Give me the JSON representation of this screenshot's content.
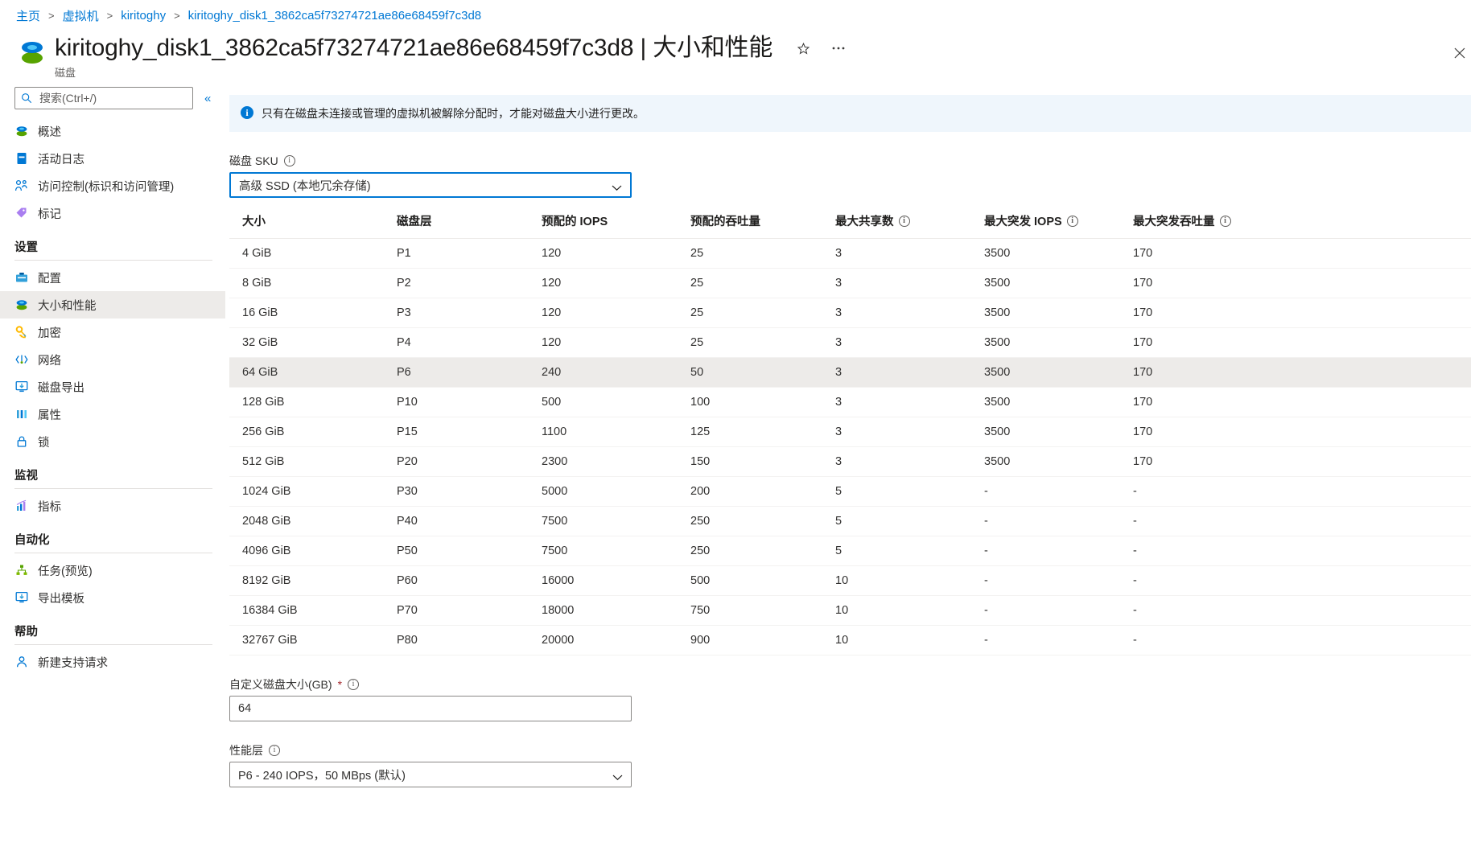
{
  "breadcrumb": {
    "items": [
      {
        "label": "主页"
      },
      {
        "label": "虚拟机"
      },
      {
        "label": "kiritoghy"
      },
      {
        "label": "kiritoghy_disk1_3862ca5f73274721ae86e68459f7c3d8"
      }
    ],
    "separator": ">"
  },
  "header": {
    "title": "kiritoghy_disk1_3862ca5f73274721ae86e68459f7c3d8 | 大小和性能",
    "subtitle": "磁盘",
    "favorite_icon": "star-outline-icon",
    "more_icon": "ellipsis-icon",
    "close_icon": "close-icon"
  },
  "sidebar": {
    "search": {
      "placeholder": "搜索(Ctrl+/)",
      "value": "",
      "icon": "search-icon"
    },
    "collapse_label": "«",
    "top_items": [
      {
        "label": "概述",
        "icon": "disk-icon",
        "selected": false
      },
      {
        "label": "活动日志",
        "icon": "activity-log-icon",
        "selected": false
      },
      {
        "label": "访问控制(标识和访问管理)",
        "icon": "access-control-icon",
        "selected": false
      },
      {
        "label": "标记",
        "icon": "tag-icon",
        "selected": false
      }
    ],
    "groups": [
      {
        "title": "设置",
        "items": [
          {
            "label": "配置",
            "icon": "configuration-icon",
            "selected": false
          },
          {
            "label": "大小和性能",
            "icon": "disk-icon",
            "selected": true
          },
          {
            "label": "加密",
            "icon": "key-icon",
            "selected": false
          },
          {
            "label": "网络",
            "icon": "network-icon",
            "selected": false
          },
          {
            "label": "磁盘导出",
            "icon": "disk-export-icon",
            "selected": false
          },
          {
            "label": "属性",
            "icon": "properties-icon",
            "selected": false
          },
          {
            "label": "锁",
            "icon": "lock-icon",
            "selected": false
          }
        ]
      },
      {
        "title": "监视",
        "items": [
          {
            "label": "指标",
            "icon": "metrics-icon",
            "selected": false
          }
        ]
      },
      {
        "title": "自动化",
        "items": [
          {
            "label": "任务(预览)",
            "icon": "tasks-icon",
            "selected": false
          },
          {
            "label": "导出模板",
            "icon": "export-template-icon",
            "selected": false
          }
        ]
      },
      {
        "title": "帮助",
        "items": [
          {
            "label": "新建支持请求",
            "icon": "support-request-icon",
            "selected": false
          }
        ]
      }
    ]
  },
  "main": {
    "info_banner": {
      "icon": "info-icon",
      "text": "只有在磁盘未连接或管理的虚拟机被解除分配时，才能对磁盘大小进行更改。"
    },
    "disk_sku": {
      "label": "磁盘 SKU",
      "info_icon": "info-circle-icon",
      "value": "高级 SSD (本地冗余存储)",
      "chevron": "chevron-down-icon"
    },
    "custom_size": {
      "label": "自定义磁盘大小(GB)",
      "required_marker": "*",
      "info_icon": "info-circle-icon",
      "value": "64"
    },
    "performance_tier": {
      "label": "性能层",
      "info_icon": "info-circle-icon",
      "value": "P6 - 240 IOPS，50 MBps (默认)",
      "chevron": "chevron-down-icon"
    }
  },
  "chart_data": {
    "type": "table",
    "title": "磁盘 SKU 大小与性能表",
    "columns": [
      {
        "key": "size",
        "label": "大小",
        "info": false
      },
      {
        "key": "tier",
        "label": "磁盘层",
        "info": false
      },
      {
        "key": "iops",
        "label": "预配的 IOPS",
        "info": false
      },
      {
        "key": "thr",
        "label": "预配的吞吐量",
        "info": false
      },
      {
        "key": "shares",
        "label": "最大共享数",
        "info": true
      },
      {
        "key": "burst",
        "label": "最大突发 IOPS",
        "info": true
      },
      {
        "key": "bthr",
        "label": "最大突发吞吐量",
        "info": true
      }
    ],
    "selected_row_index": 4,
    "rows": [
      {
        "size": "4 GiB",
        "tier": "P1",
        "iops": "120",
        "thr": "25",
        "shares": "3",
        "burst": "3500",
        "bthr": "170"
      },
      {
        "size": "8 GiB",
        "tier": "P2",
        "iops": "120",
        "thr": "25",
        "shares": "3",
        "burst": "3500",
        "bthr": "170"
      },
      {
        "size": "16 GiB",
        "tier": "P3",
        "iops": "120",
        "thr": "25",
        "shares": "3",
        "burst": "3500",
        "bthr": "170"
      },
      {
        "size": "32 GiB",
        "tier": "P4",
        "iops": "120",
        "thr": "25",
        "shares": "3",
        "burst": "3500",
        "bthr": "170"
      },
      {
        "size": "64 GiB",
        "tier": "P6",
        "iops": "240",
        "thr": "50",
        "shares": "3",
        "burst": "3500",
        "bthr": "170"
      },
      {
        "size": "128 GiB",
        "tier": "P10",
        "iops": "500",
        "thr": "100",
        "shares": "3",
        "burst": "3500",
        "bthr": "170"
      },
      {
        "size": "256 GiB",
        "tier": "P15",
        "iops": "1100",
        "thr": "125",
        "shares": "3",
        "burst": "3500",
        "bthr": "170"
      },
      {
        "size": "512 GiB",
        "tier": "P20",
        "iops": "2300",
        "thr": "150",
        "shares": "3",
        "burst": "3500",
        "bthr": "170"
      },
      {
        "size": "1024 GiB",
        "tier": "P30",
        "iops": "5000",
        "thr": "200",
        "shares": "5",
        "burst": "-",
        "bthr": "-"
      },
      {
        "size": "2048 GiB",
        "tier": "P40",
        "iops": "7500",
        "thr": "250",
        "shares": "5",
        "burst": "-",
        "bthr": "-"
      },
      {
        "size": "4096 GiB",
        "tier": "P50",
        "iops": "7500",
        "thr": "250",
        "shares": "5",
        "burst": "-",
        "bthr": "-"
      },
      {
        "size": "8192 GiB",
        "tier": "P60",
        "iops": "16000",
        "thr": "500",
        "shares": "10",
        "burst": "-",
        "bthr": "-"
      },
      {
        "size": "16384 GiB",
        "tier": "P70",
        "iops": "18000",
        "thr": "750",
        "shares": "10",
        "burst": "-",
        "bthr": "-"
      },
      {
        "size": "32767 GiB",
        "tier": "P80",
        "iops": "20000",
        "thr": "900",
        "shares": "10",
        "burst": "-",
        "bthr": "-"
      }
    ]
  },
  "colors": {
    "accent": "#0078d4",
    "info_bg": "#eff6fc",
    "selected_row": "#edebe9",
    "required": "#a4262c"
  }
}
